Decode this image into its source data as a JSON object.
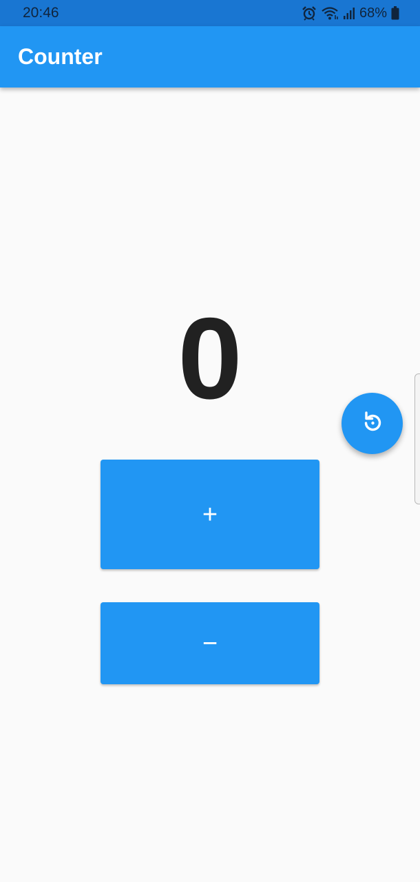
{
  "status_bar": {
    "time": "20:46",
    "battery": "68%",
    "icons": [
      "alarm-icon",
      "wifi-icon",
      "signal-icon",
      "battery-icon"
    ]
  },
  "app_bar": {
    "title": "Counter"
  },
  "counter": {
    "value": "0"
  },
  "buttons": {
    "increment_label": "+",
    "decrement_label": "−",
    "reset_icon": "reset-icon"
  },
  "colors": {
    "primary": "#2196f3",
    "status_bar": "#1976d2",
    "background": "#fafafa",
    "counter_text": "#212121"
  }
}
